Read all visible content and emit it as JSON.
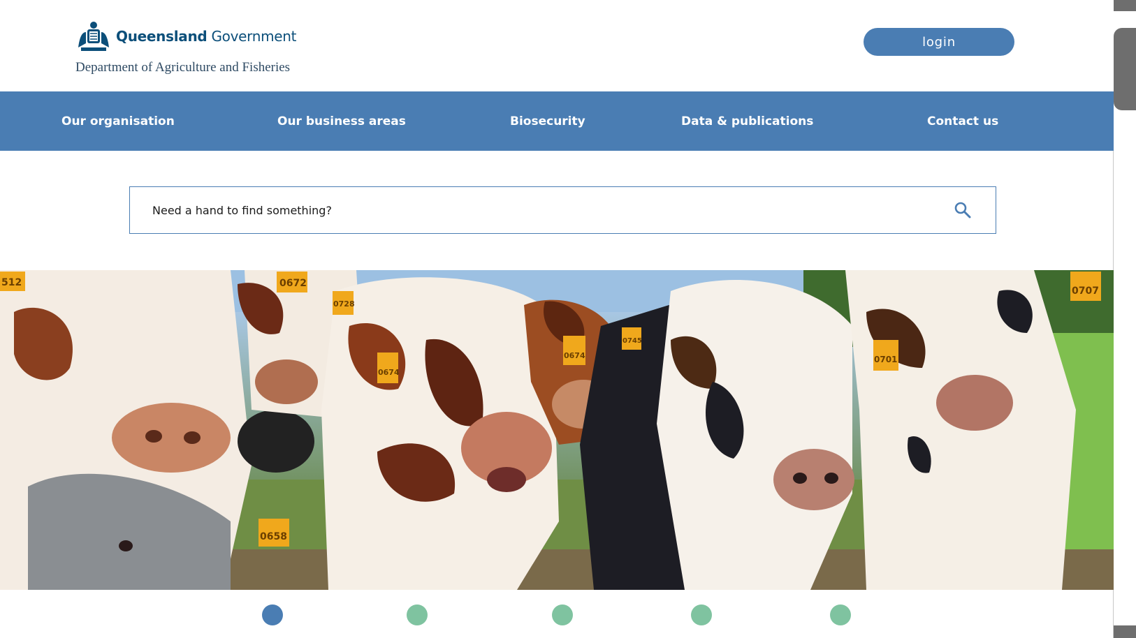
{
  "header": {
    "logo": {
      "gov_name_bold": "Queensland",
      "gov_name_rest": " Government",
      "department": "Department of Agriculture and Fisheries",
      "crest_icon": "queensland-crest-icon"
    },
    "login_label": "login"
  },
  "nav": {
    "items": [
      {
        "label": "Our organisation"
      },
      {
        "label": "Our business areas"
      },
      {
        "label": "Biosecurity"
      },
      {
        "label": "Data & publications"
      },
      {
        "label": "Contact us"
      }
    ]
  },
  "search": {
    "placeholder": "Need a hand to find something?",
    "icon": "search-icon"
  },
  "hero": {
    "image": "cattle-herd-photo",
    "ear_tags": [
      "512",
      "0672",
      "0728",
      "0674",
      "0674",
      "0745",
      "0707",
      "0701",
      "0658"
    ]
  },
  "carousel": {
    "dot_count": 5,
    "active_index": 0
  },
  "colors": {
    "primary": "#4a7db3",
    "brand_text": "#0c4f7a",
    "dot_active": "#4a7db3",
    "dot_inactive": "#7fc3a0",
    "white": "#ffffff"
  }
}
